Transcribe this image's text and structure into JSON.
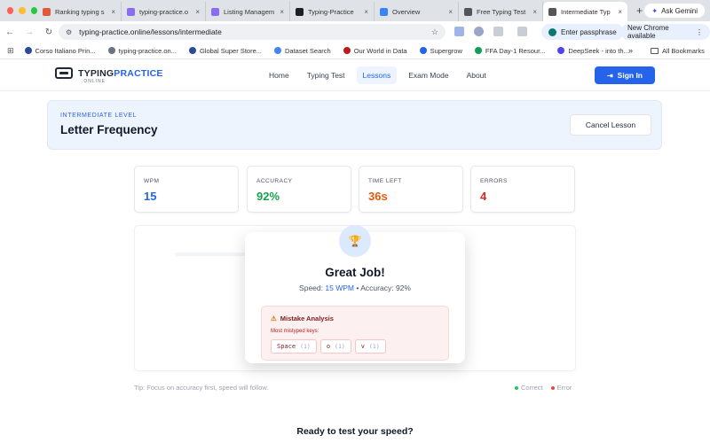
{
  "browser": {
    "tabs": [
      {
        "label": "Ranking typing s",
        "fav_color": "#e05a3a"
      },
      {
        "label": "typing-practice.o",
        "fav_color": "#8b6cf0"
      },
      {
        "label": "Listing Managem",
        "fav_color": "#8b6cf0"
      },
      {
        "label": "Typing-Practice",
        "fav_color": "#1f1f1f"
      },
      {
        "label": "Overview",
        "fav_color": "#3b82f6"
      },
      {
        "label": "Free Typing Test",
        "fav_color": "#555555"
      },
      {
        "label": "Intermediate Typ",
        "fav_color": "#555555"
      }
    ],
    "new_tab": "+",
    "gemini": "Ask Gemini",
    "url": "typing-practice.online/lessons/intermediate",
    "passphrase": "Enter passphrase",
    "update": "New Chrome available",
    "bookmarks": [
      {
        "label": "Corso Italiano Prin...",
        "color": "#2b4a9a"
      },
      {
        "label": "typing-practice.on...",
        "color": "#6b7280"
      },
      {
        "label": "Global Super Store...",
        "color": "#2b4a9a"
      },
      {
        "label": "Dataset Search",
        "color": "#4285f4"
      },
      {
        "label": "Our World in Data",
        "color": "#b91c1c"
      },
      {
        "label": "Supergrow",
        "color": "#2563eb"
      },
      {
        "label": "FFA Day-1 Resour...",
        "color": "#0f9d58"
      },
      {
        "label": "DeepSeek - into th...",
        "color": "#4f46e5"
      }
    ],
    "all_bookmarks": "All Bookmarks",
    "more": "»"
  },
  "site": {
    "logo_main": "TYPING",
    "logo_accent": "PRACTICE",
    "logo_sub": ".ONLINE",
    "nav": [
      "Home",
      "Typing Test",
      "Lessons",
      "Exam Mode",
      "About"
    ],
    "active_nav": "Lessons",
    "sign_in": "Sign In"
  },
  "lesson": {
    "level": "INTERMEDIATE LEVEL",
    "title": "Letter Frequency",
    "cancel": "Cancel Lesson"
  },
  "stats": [
    {
      "label": "WPM",
      "value": "15",
      "color": "#2563eb"
    },
    {
      "label": "ACCURACY",
      "value": "92%",
      "color": "#16a34a"
    },
    {
      "label": "TIME LEFT",
      "value": "36s",
      "color": "#ea580c"
    },
    {
      "label": "ERRORS",
      "value": "4",
      "color": "#dc2626"
    }
  ],
  "result": {
    "trophy": "🏆",
    "title": "Great Job!",
    "speed_label": "Speed:",
    "speed_value": "15 WPM",
    "separator": "•",
    "accuracy_label": "Accuracy:",
    "accuracy_value": "92%",
    "mistake_title": "Mistake Analysis",
    "mistake_sub": "Most mistyped keys:",
    "keys": [
      {
        "key": "Space",
        "count": "(1)"
      },
      {
        "key": "o",
        "count": "(1)"
      },
      {
        "key": "v",
        "count": "(1)"
      }
    ]
  },
  "tip": "Tip: Focus on accuracy first, speed will follow.",
  "legend": {
    "correct": "Correct",
    "error": "Error",
    "correct_color": "#22c55e",
    "error_color": "#ef4444"
  },
  "ready": "Ready to test your speed?"
}
